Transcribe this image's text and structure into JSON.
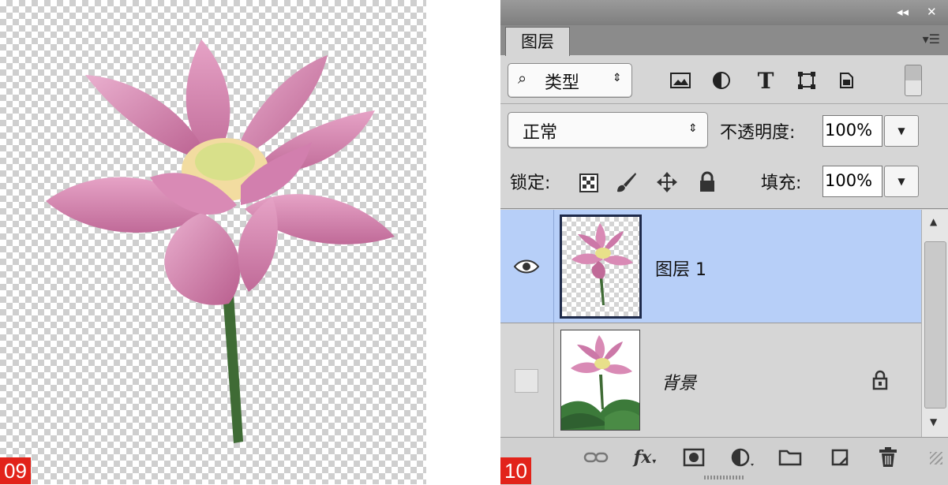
{
  "figure_labels": {
    "left": "09",
    "right": "10"
  },
  "panel": {
    "tab_label": "图层",
    "filter": {
      "icon": "search-icon",
      "label": "类型"
    },
    "filter_icons": [
      "image-filter-icon",
      "adjustment-filter-icon",
      "type-filter-icon",
      "shape-filter-icon",
      "smart-object-filter-icon",
      "filter-toggle-icon"
    ],
    "blend_mode": "正常",
    "opacity_label": "不透明度:",
    "opacity_value": "100%",
    "lock_label": "锁定:",
    "lock_icons": [
      "lock-transparent-pixels-icon",
      "lock-image-pixels-icon",
      "lock-position-icon",
      "lock-all-icon"
    ],
    "fill_label": "填充:",
    "fill_value": "100%",
    "layers": [
      {
        "name": "图层 1",
        "visible": true,
        "selected": true,
        "locked": false
      },
      {
        "name": "背景",
        "visible": false,
        "selected": false,
        "locked": true
      }
    ],
    "bottom_icons": [
      "link-layers-icon",
      "fx-icon",
      "add-mask-icon",
      "adjustment-layer-icon",
      "new-group-icon",
      "new-layer-icon",
      "delete-layer-icon"
    ],
    "bottom_fx_text": "fx"
  },
  "colors": {
    "selected_row": "#b7cff8",
    "label_red": "#e2231a"
  }
}
